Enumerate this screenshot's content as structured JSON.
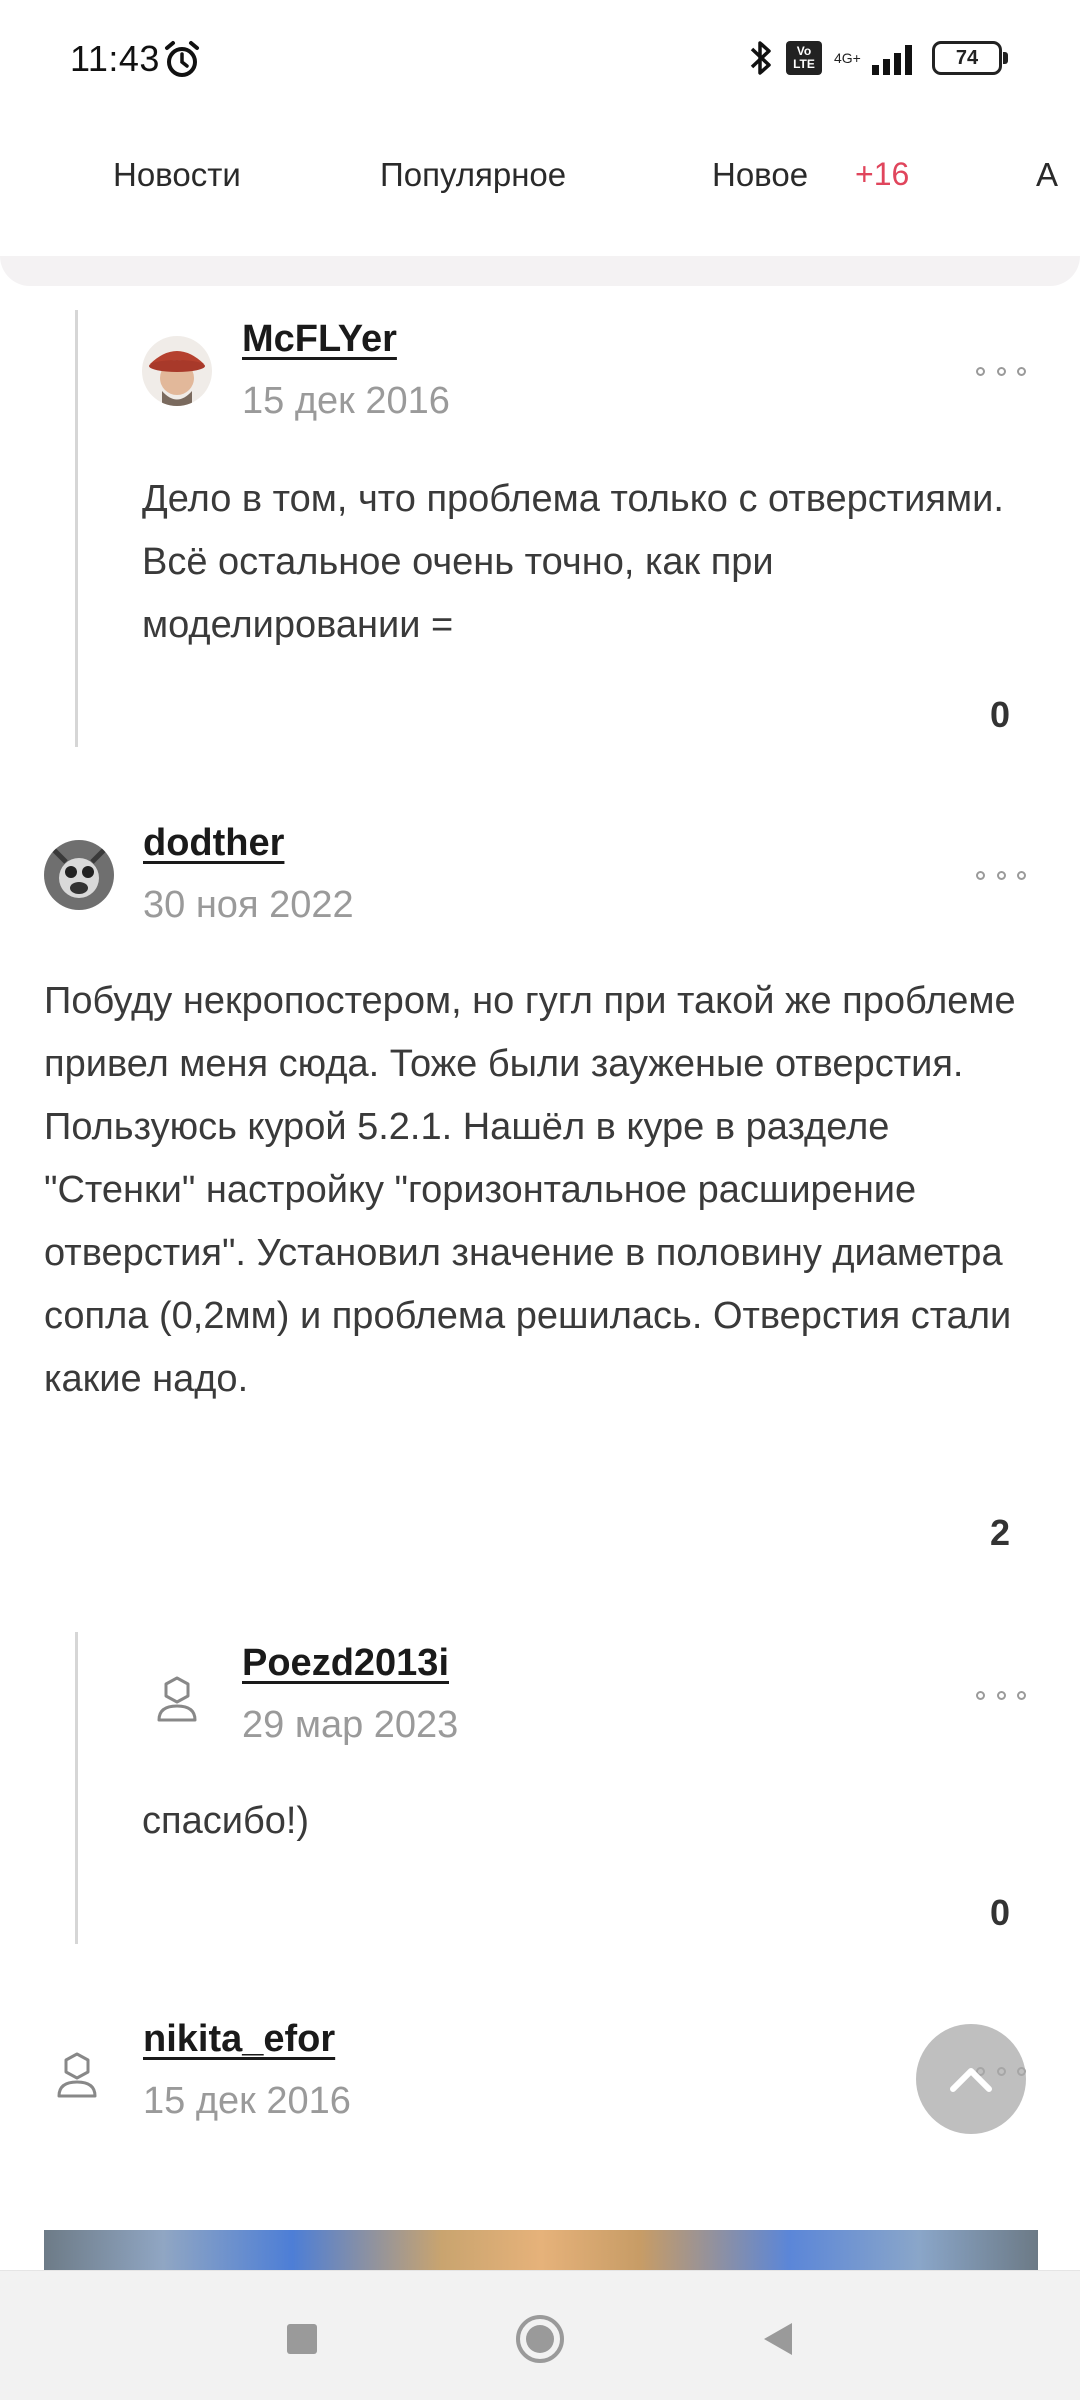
{
  "status_bar": {
    "time": "11:43",
    "network": "4G+",
    "volte": "Vo LTE",
    "battery": "74"
  },
  "tabs": [
    {
      "label": "Новости"
    },
    {
      "label": "Популярное"
    },
    {
      "label": "Новое",
      "badge": "+16"
    },
    {
      "label": "А"
    }
  ],
  "comments": [
    {
      "username": "McFLYer",
      "date": "15 дек 2016",
      "text": "Дело в том, что проблема только с отверстиями. Всё остальное очень точно, как при моделировании =",
      "rating": "0"
    },
    {
      "username": "dodther",
      "date": "30 ноя 2022",
      "text": "Побуду некропостером, но гугл при такой же проблеме привел меня сюда. Тоже были зауженые отверстия. Пользуюсь курой 5.2.1. Нашёл в куре в разделе \"Стенки\" настройку \"горизонтальное расширение отверстия\". Установил значение в половину диаметра сопла (0,2мм) и проблема решилась. Отверстия стали какие надо.",
      "rating": "2"
    },
    {
      "username": "Poezd2013i",
      "date": "29 мар 2023",
      "text": "спасибо!)",
      "rating": "0"
    },
    {
      "username": "nikita_efor",
      "date": "15 дек 2016"
    }
  ],
  "colors": {
    "accent_badge": "#e0455c",
    "text": "#3a3a3a",
    "muted": "#9a9a9a"
  },
  "icons": {
    "alarm": "alarm-clock-icon",
    "bluetooth": "bluetooth-icon",
    "signal": "signal-bars-icon",
    "more": "more-dots-icon",
    "default_avatar": "user-placeholder-icon",
    "scroll_up": "chevron-up-icon",
    "nav_recents": "square-icon",
    "nav_home": "circle-icon",
    "nav_back": "triangle-back-icon"
  }
}
